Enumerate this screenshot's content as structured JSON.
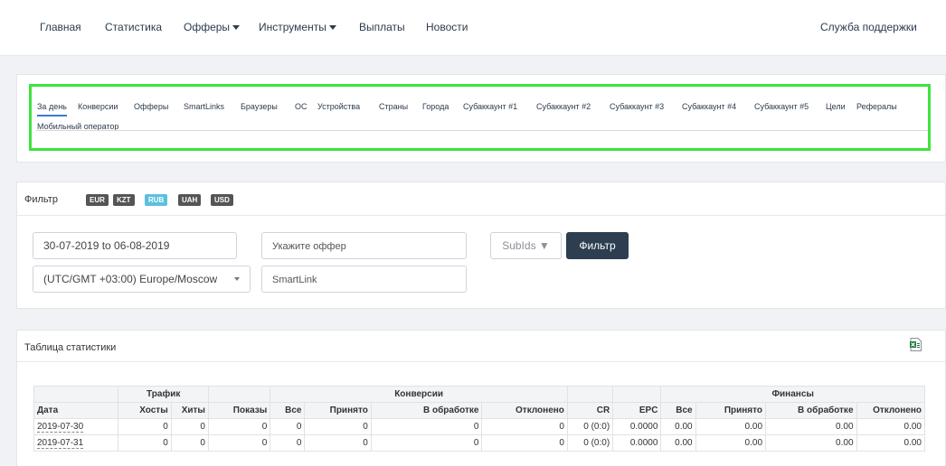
{
  "nav": {
    "home": "Главная",
    "stats": "Статистика",
    "offers": "Офферы",
    "tools": "Инструменты",
    "payouts": "Выплаты",
    "news": "Новости",
    "support": "Служба поддержки"
  },
  "tabs": [
    "За день",
    "Конверсии",
    "Офферы",
    "SmartLinks",
    "Браузеры",
    "ОС",
    "Устройства",
    "Страны",
    "Города",
    "Субаккаунт #1",
    "Субаккаунт #2",
    "Субаккаунт #3",
    "Субаккаунт #4",
    "Субаккаунт #5",
    "Цели",
    "Рефералы",
    "Мобильный оператор"
  ],
  "active_tab": "За день",
  "filter": {
    "title": "Фильтр",
    "currencies": [
      "EUR",
      "KZT",
      "RUB",
      "UAH",
      "USD"
    ],
    "active_currency": "RUB",
    "date_range": "30-07-2019 to 06-08-2019",
    "timezone": "(UTC/GMT +03:00) Europe/Moscow",
    "offer_placeholder": "Укажите оффер",
    "smartlink_placeholder": "SmartLink",
    "subids_label": "SubIds ▼",
    "filter_button": "Фильтр"
  },
  "stats": {
    "title": "Таблица статистики",
    "groups": {
      "traffic": "Трафик",
      "conversions": "Конверсии",
      "finance": "Финансы"
    },
    "columns": [
      "Дата",
      "Хосты",
      "Хиты",
      "Показы",
      "Все",
      "Принято",
      "В обработке",
      "Отклонено",
      "CR",
      "EPC",
      "Все",
      "Принято",
      "В обработке",
      "Отклонено"
    ],
    "rows": [
      [
        "2019-07-30",
        "0",
        "0",
        "0",
        "0",
        "0",
        "0",
        "0",
        "0 (0:0)",
        "0.0000",
        "0.00",
        "0.00",
        "0.00",
        "0.00"
      ],
      [
        "2019-07-31",
        "0",
        "0",
        "0",
        "0",
        "0",
        "0",
        "0",
        "0 (0:0)",
        "0.0000",
        "0.00",
        "0.00",
        "0.00",
        "0.00"
      ]
    ]
  },
  "colors": {
    "highlight": "#3ee33e",
    "active_currency": "#5bc0de",
    "filter_button": "#2c3e50"
  }
}
